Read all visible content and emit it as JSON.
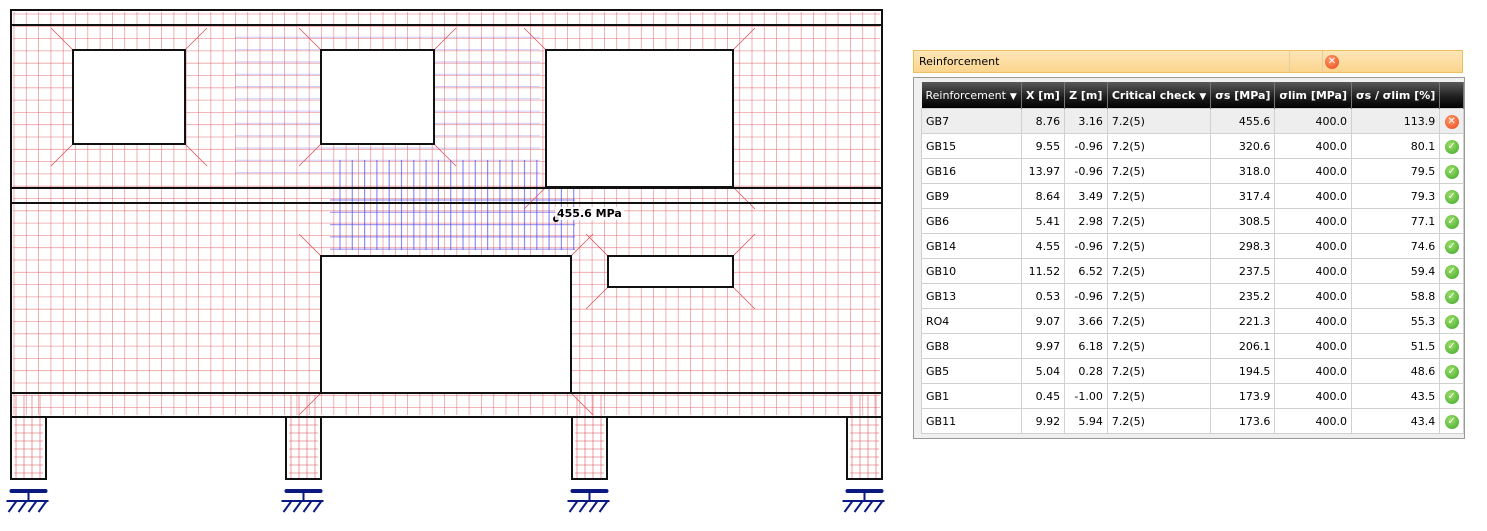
{
  "drawing": {
    "annotation": "455.6 MPa",
    "colors": {
      "rebar_x": "#d9545a",
      "rebar_z": "#4a3df0",
      "outline": "#111111",
      "support": "#0b1a80"
    }
  },
  "panel": {
    "title": "Reinforcement",
    "title_icon": "error-icon",
    "columns": [
      "Reinforcement",
      "X [m]",
      "Z [m]",
      "Critical check",
      "σs [MPa]",
      "σlim [MPa]",
      "σs / σlim [%]",
      ""
    ],
    "rows": [
      {
        "name": "GB7",
        "x": "8.76",
        "z": "3.16",
        "check": "7.2(5)",
        "s": "455.6",
        "lim": "400.0",
        "ratio": "113.9",
        "status": "error"
      },
      {
        "name": "GB15",
        "x": "9.55",
        "z": "-0.96",
        "check": "7.2(5)",
        "s": "320.6",
        "lim": "400.0",
        "ratio": "80.1",
        "status": "ok"
      },
      {
        "name": "GB16",
        "x": "13.97",
        "z": "-0.96",
        "check": "7.2(5)",
        "s": "318.0",
        "lim": "400.0",
        "ratio": "79.5",
        "status": "ok"
      },
      {
        "name": "GB9",
        "x": "8.64",
        "z": "3.49",
        "check": "7.2(5)",
        "s": "317.4",
        "lim": "400.0",
        "ratio": "79.3",
        "status": "ok"
      },
      {
        "name": "GB6",
        "x": "5.41",
        "z": "2.98",
        "check": "7.2(5)",
        "s": "308.5",
        "lim": "400.0",
        "ratio": "77.1",
        "status": "ok"
      },
      {
        "name": "GB14",
        "x": "4.55",
        "z": "-0.96",
        "check": "7.2(5)",
        "s": "298.3",
        "lim": "400.0",
        "ratio": "74.6",
        "status": "ok"
      },
      {
        "name": "GB10",
        "x": "11.52",
        "z": "6.52",
        "check": "7.2(5)",
        "s": "237.5",
        "lim": "400.0",
        "ratio": "59.4",
        "status": "ok"
      },
      {
        "name": "GB13",
        "x": "0.53",
        "z": "-0.96",
        "check": "7.2(5)",
        "s": "235.2",
        "lim": "400.0",
        "ratio": "58.8",
        "status": "ok"
      },
      {
        "name": "RO4",
        "x": "9.07",
        "z": "3.66",
        "check": "7.2(5)",
        "s": "221.3",
        "lim": "400.0",
        "ratio": "55.3",
        "status": "ok"
      },
      {
        "name": "GB8",
        "x": "9.97",
        "z": "6.18",
        "check": "7.2(5)",
        "s": "206.1",
        "lim": "400.0",
        "ratio": "51.5",
        "status": "ok"
      },
      {
        "name": "GB5",
        "x": "5.04",
        "z": "0.28",
        "check": "7.2(5)",
        "s": "194.5",
        "lim": "400.0",
        "ratio": "48.6",
        "status": "ok"
      },
      {
        "name": "GB1",
        "x": "0.45",
        "z": "-1.00",
        "check": "7.2(5)",
        "s": "173.9",
        "lim": "400.0",
        "ratio": "43.5",
        "status": "ok"
      },
      {
        "name": "GB11",
        "x": "9.92",
        "z": "5.94",
        "check": "7.2(5)",
        "s": "173.6",
        "lim": "400.0",
        "ratio": "43.4",
        "status": "ok"
      }
    ]
  }
}
